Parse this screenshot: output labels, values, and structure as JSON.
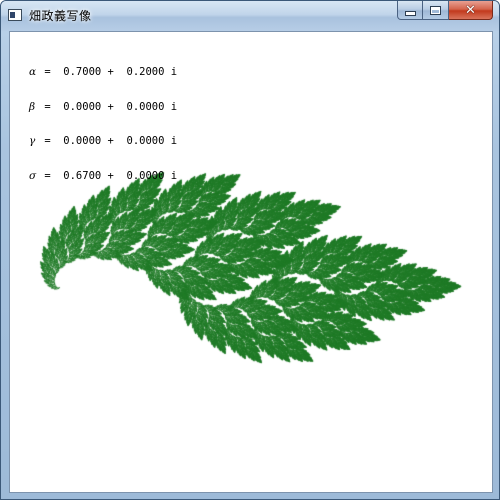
{
  "window": {
    "title": "畑政義写像",
    "icon": "app-window-icon",
    "buttons": {
      "minimize_icon": "minimize-icon",
      "maximize_icon": "maximize-icon",
      "close_glyph": "✕"
    }
  },
  "parameters": [
    {
      "symbol": "α",
      "text": " =  0.7000 +  0.2000 i"
    },
    {
      "symbol": "β",
      "text": " =  0.0000 +  0.0000 i"
    },
    {
      "symbol": "γ",
      "text": " =  0.0000 +  0.0000 i"
    },
    {
      "symbol": "σ",
      "text": " =  0.6700 +  0.0000 i"
    }
  ],
  "fractal": {
    "alpha": [
      0.7,
      0.2
    ],
    "beta": [
      0.0,
      0.0
    ],
    "gamma": [
      0.0,
      0.0
    ],
    "delta": [
      0.67,
      0.0
    ],
    "color": "#1f7a26"
  }
}
